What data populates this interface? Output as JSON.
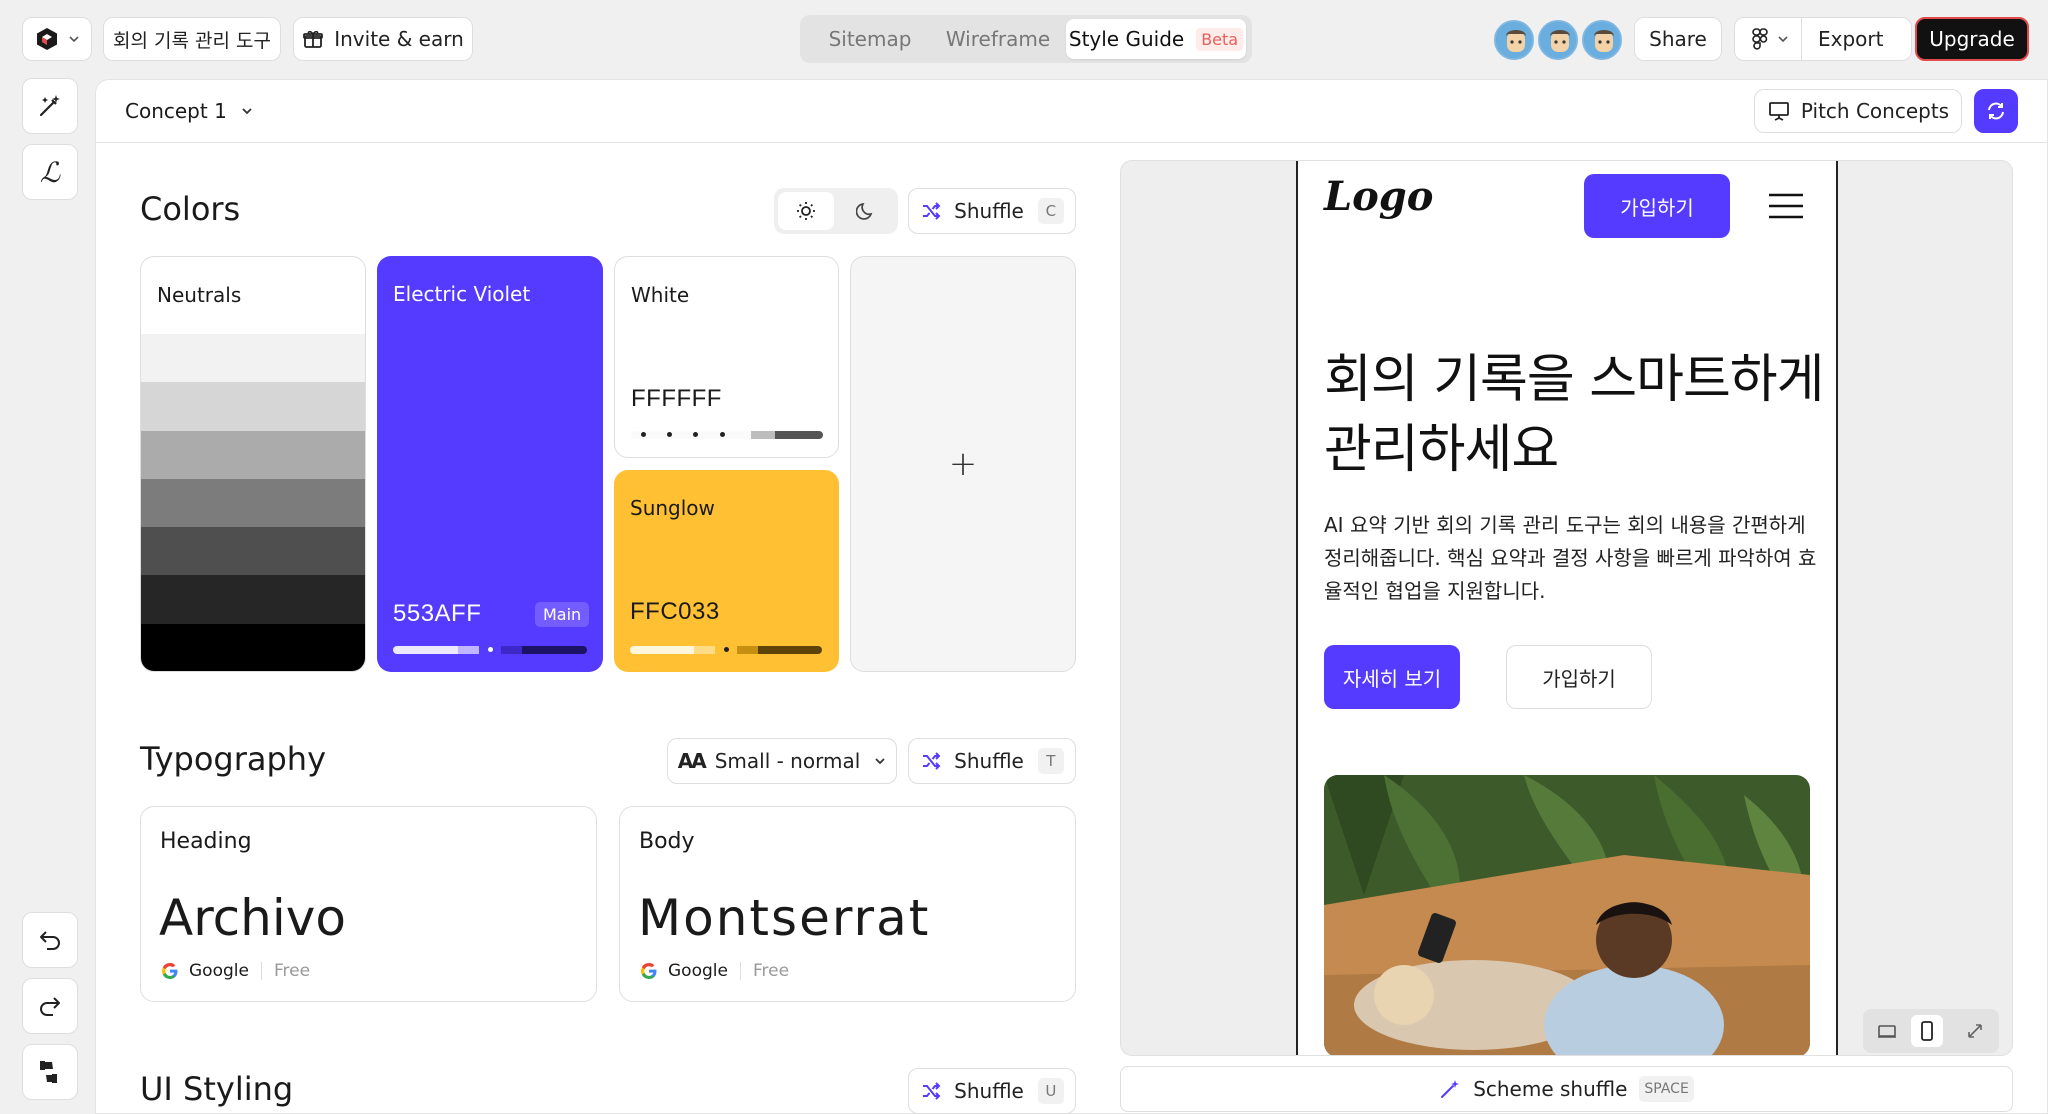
{
  "topbar": {
    "project_name": "회의 기록 관리 도구",
    "invite_label": "Invite & earn",
    "tabs": [
      {
        "label": "Sitemap"
      },
      {
        "label": "Wireframe"
      },
      {
        "label": "Style Guide",
        "badge": "Beta"
      }
    ],
    "share_label": "Share",
    "export_label": "Export",
    "upgrade_label": "Upgrade"
  },
  "concept": {
    "name": "Concept 1",
    "pitch_label": "Pitch Concepts"
  },
  "colors": {
    "title": "Colors",
    "shuffle_label": "Shuffle",
    "shuffle_key": "C",
    "add_symbol": "+",
    "swatches": [
      {
        "name": "Neutrals"
      },
      {
        "name": "Electric Violet",
        "hex": "553AFF",
        "badge": "Main",
        "color": "#553AFF"
      },
      {
        "name": "White",
        "hex": "FFFFFF",
        "color": "#FFFFFF"
      },
      {
        "name": "Sunglow",
        "hex": "FFC033",
        "color": "#FFC033"
      }
    ],
    "neutral_shades": [
      "#f2f2f2",
      "#d6d6d6",
      "#ababab",
      "#7c7c7c",
      "#4f4f4f",
      "#262626",
      "#000000"
    ]
  },
  "typography": {
    "title": "Typography",
    "size_label": "Small - normal",
    "shuffle_label": "Shuffle",
    "shuffle_key": "T",
    "fonts": [
      {
        "role": "Heading",
        "family": "Archivo",
        "source": "Google",
        "license": "Free"
      },
      {
        "role": "Body",
        "family": "Montserrat",
        "source": "Google",
        "license": "Free"
      }
    ]
  },
  "ui_styling": {
    "title": "UI Styling",
    "shuffle_label": "Shuffle",
    "shuffle_key": "U"
  },
  "preview": {
    "logo": "Logo",
    "signup_nav": "가입하기",
    "hero_title": "회의 기록을 스마트하게 관리하세요",
    "hero_body": "AI 요약 기반 회의 기록 관리 도구는 회의 내용을 간편하게 정리해줍니다. 핵심 요약과 결정 사항을 빠르게 파악하여 효율적인 협업을 지원합니다.",
    "primary_cta": "자세히 보기",
    "secondary_cta": "가입하기"
  },
  "scheme_shuffle": {
    "label": "Scheme shuffle",
    "key": "SPACE"
  }
}
